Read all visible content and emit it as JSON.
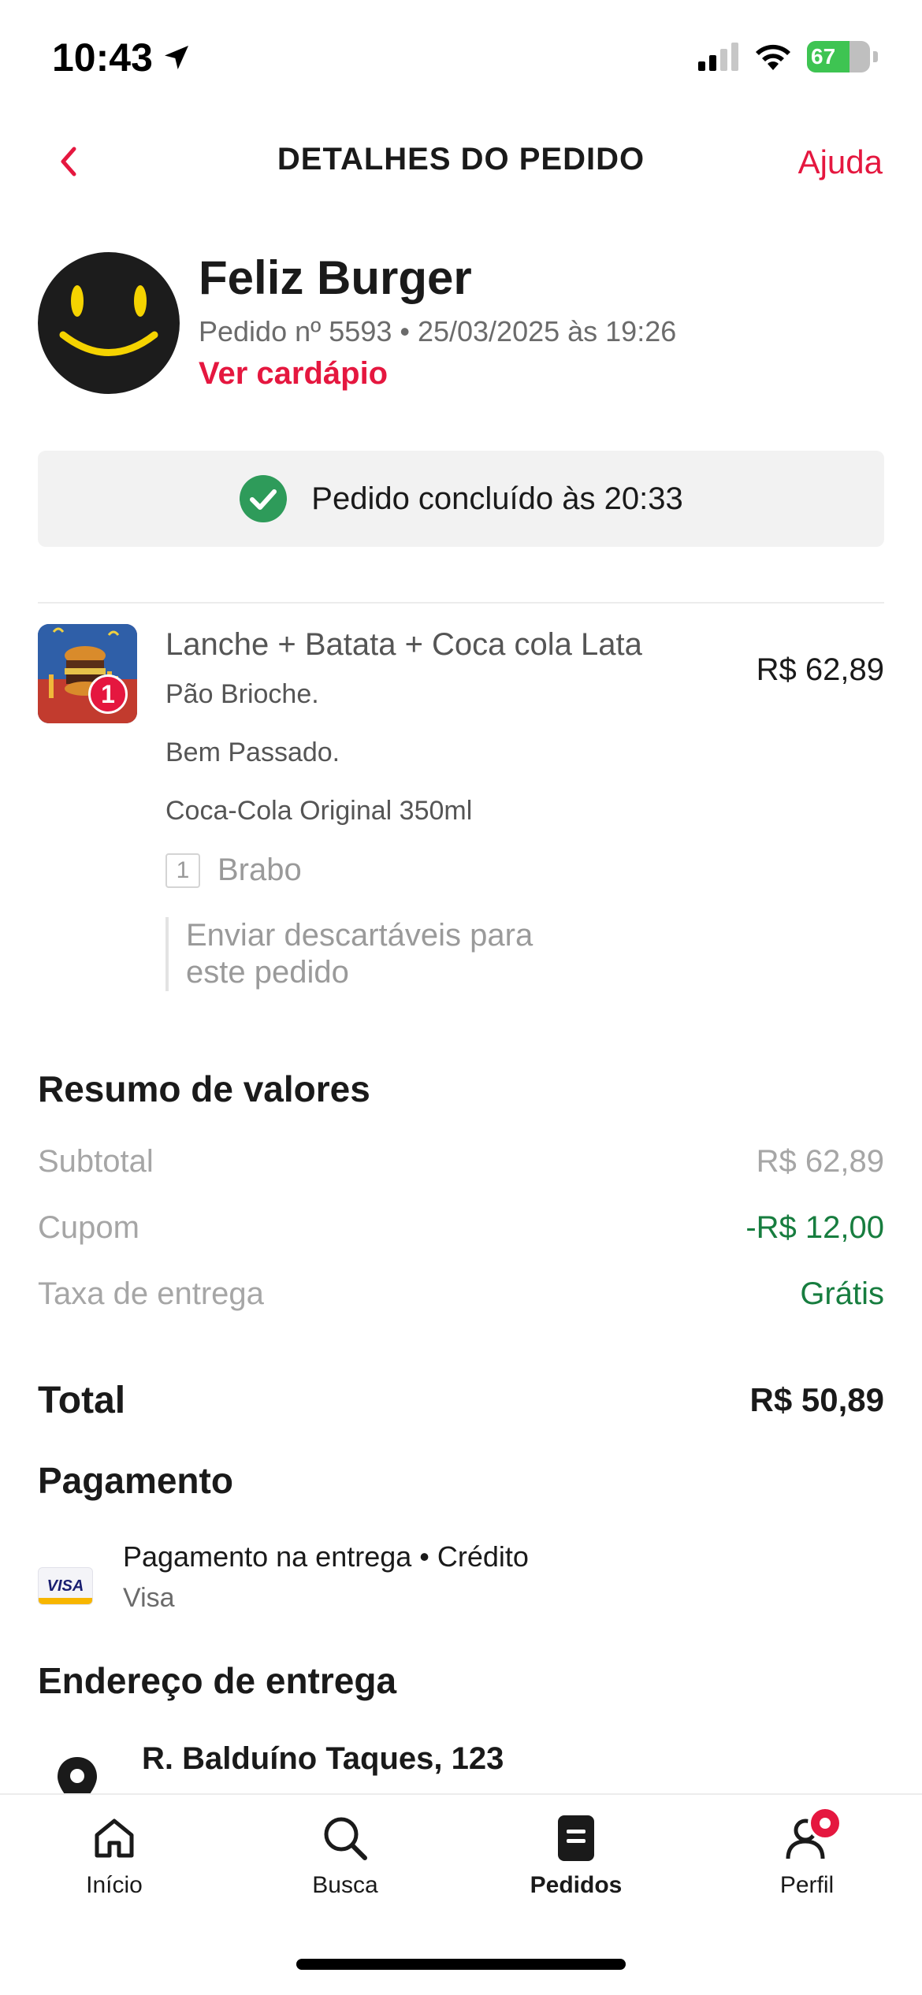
{
  "status_bar": {
    "time": "10:43",
    "battery": "67",
    "battery_level": 0.67,
    "icons": [
      "location-arrow-icon",
      "signal-icon",
      "wifi-icon",
      "battery-icon"
    ]
  },
  "header": {
    "title": "DETALHES DO PEDIDO",
    "back_icon": "chevron-left-icon",
    "help": "Ajuda"
  },
  "restaurant": {
    "name": "Feliz Burger",
    "order_info": "Pedido nº 5593 • 25/03/2025 às 19:26",
    "menu_link": "Ver cardápio"
  },
  "order_status": {
    "icon": "check-circle-icon",
    "text": "Pedido concluído às 20:33"
  },
  "item": {
    "quantity": "1",
    "name": "Lanche + Batata + Coca cola Lata",
    "price": "R$ 62,89",
    "options": [
      "Pão Brioche.",
      "Bem Passado.",
      "Coca-Cola Original 350ml"
    ],
    "extra_qty": "1",
    "extra_name": "Brabo",
    "note": "Enviar descartáveis para este pedido"
  },
  "summary": {
    "title": "Resumo de valores",
    "subtotal_label": "Subtotal",
    "subtotal_value": "R$ 62,89",
    "coupon_label": "Cupom",
    "coupon_value": "-R$ 12,00",
    "delivery_label": "Taxa de entrega",
    "delivery_value": "Grátis",
    "total_label": "Total",
    "total_value": "R$ 50,89"
  },
  "payment": {
    "title": "Pagamento",
    "method": "Pagamento na entrega • Crédito",
    "brand": "Visa",
    "card_text": "VISA"
  },
  "address": {
    "title": "Endereço de entrega",
    "line1": "R. Balduíno Taques, 123"
  },
  "tabs": [
    {
      "label": "Início",
      "icon": "home-icon",
      "active": false
    },
    {
      "label": "Busca",
      "icon": "search-icon",
      "active": false
    },
    {
      "label": "Pedidos",
      "icon": "orders-icon",
      "active": true
    },
    {
      "label": "Perfil",
      "icon": "profile-icon",
      "active": false
    }
  ],
  "colors": {
    "accent": "#e5173f",
    "success": "#177d3f",
    "check": "#2e9b5a"
  }
}
